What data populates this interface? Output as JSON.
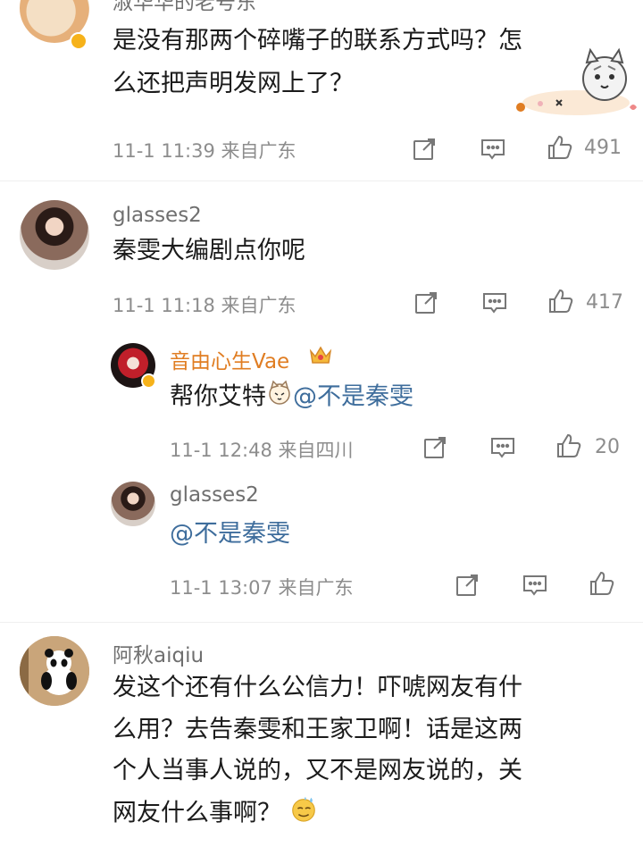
{
  "comments": [
    {
      "name": "淑华华的老号东",
      "text_lines": [
        "是没有那两个碎嘴子的联系方式吗？怎",
        "么还把声明发网上了？"
      ],
      "meta": "11-1 11:39 来自广东",
      "likes": "491"
    },
    {
      "name": "glasses2",
      "text_lines": [
        "秦雯大编剧点你呢"
      ],
      "meta": "11-1 11:18 来自广东",
      "likes": "417",
      "replies": [
        {
          "name": "音由心生Vae",
          "text_prefix": "帮你艾特",
          "mention": "@不是秦雯",
          "meta": "11-1 12:48 来自四川",
          "likes": "20"
        },
        {
          "name": "glasses2",
          "mention": "@不是秦雯",
          "meta": "11-1 13:07 来自广东",
          "likes": ""
        }
      ]
    },
    {
      "name": "阿秋aiqiu",
      "text_lines": [
        "发这个还有什么公信力！吓唬网友有什",
        "么用？去告秦雯和王家卫啊！话是这两",
        "个人当事人说的，又不是网友说的，关",
        "网友什么事啊？"
      ]
    }
  ],
  "icons": [
    "share-icon",
    "comment-icon",
    "like-icon",
    "crown-icon",
    "verified-icon",
    "cat-emoji",
    "sweat-emoji"
  ],
  "colors": {
    "mention": "#3e6d9c",
    "vip_name": "#e07d22",
    "meta": "#8d8d8d",
    "verified": "#f6b21a"
  }
}
